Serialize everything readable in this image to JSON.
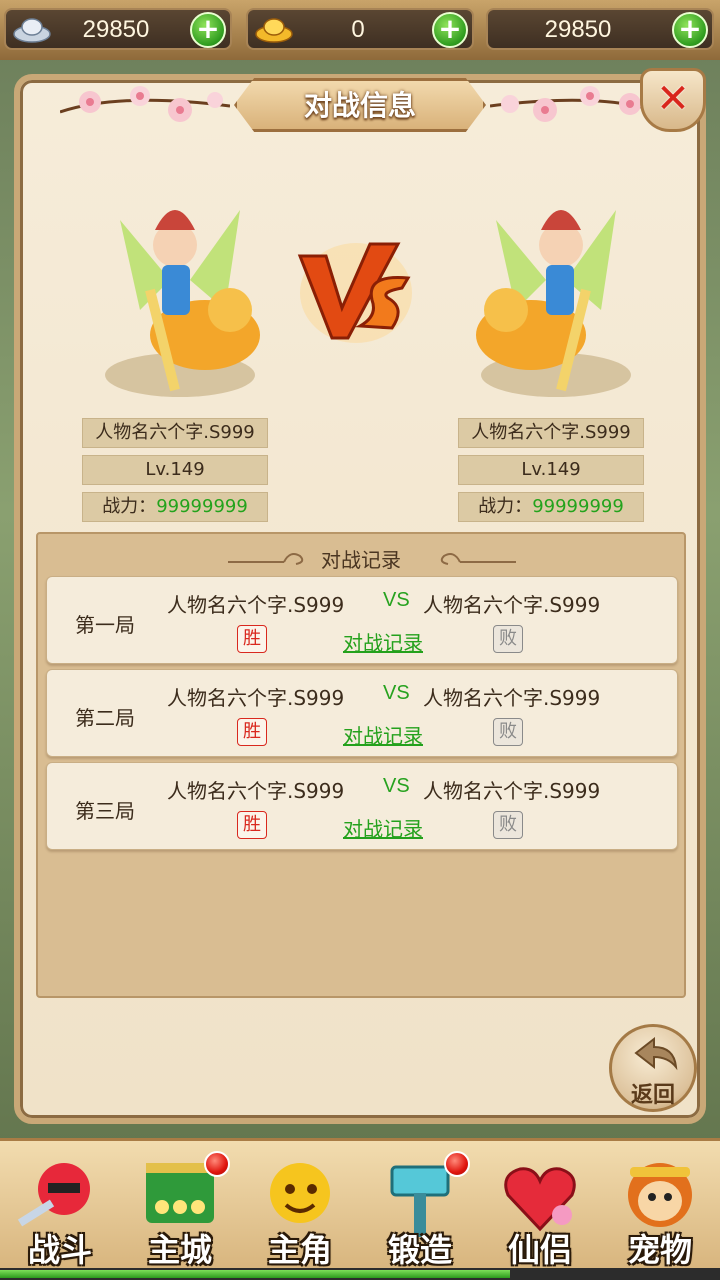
{
  "topbar": {
    "currencies": [
      {
        "icon": "silver-ingot-icon",
        "value": "29850"
      },
      {
        "icon": "gold-ingot-icon",
        "value": "0"
      },
      {
        "icon": "none",
        "value": "29850"
      }
    ],
    "plus_symbol": "+"
  },
  "panel": {
    "title": "对战信息",
    "close_symbol": "✕"
  },
  "fighters": {
    "left": {
      "name": "人物名六个字.S999",
      "level": "Lv.149",
      "power_label": "战力：",
      "power_value": "99999999"
    },
    "right": {
      "name": "人物名六个字.S999",
      "level": "Lv.149",
      "power_label": "战力：",
      "power_value": "99999999"
    }
  },
  "records": {
    "title": "对战记录",
    "vs_text": "VS",
    "link_label": "对战记录",
    "win_label": "胜",
    "lose_label": "败",
    "rounds": [
      {
        "label": "第一局",
        "player1": "人物名六个字.S999",
        "player2": "人物名六个字.S999"
      },
      {
        "label": "第二局",
        "player1": "人物名六个字.S999",
        "player2": "人物名六个字.S999"
      },
      {
        "label": "第三局",
        "player1": "人物名六个字.S999",
        "player2": "人物名六个字.S999"
      }
    ]
  },
  "back_button": {
    "label": "返回"
  },
  "bottom_nav": [
    {
      "label": "战斗",
      "icon": "red-ninja-sword-icon",
      "badge": false
    },
    {
      "label": "主城",
      "icon": "green-city-gate-icon",
      "badge": true
    },
    {
      "label": "主角",
      "icon": "yellow-hero-face-icon",
      "badge": false
    },
    {
      "label": "锻造",
      "icon": "forge-hammer-icon",
      "badge": true
    },
    {
      "label": "仙侣",
      "icon": "heart-flower-icon",
      "badge": false
    },
    {
      "label": "宠物",
      "icon": "monkey-pet-icon",
      "badge": false
    }
  ],
  "colors": {
    "accent_green": "#23a31c",
    "win_red": "#d9281e",
    "panel_bg": "#f6ecd9"
  }
}
